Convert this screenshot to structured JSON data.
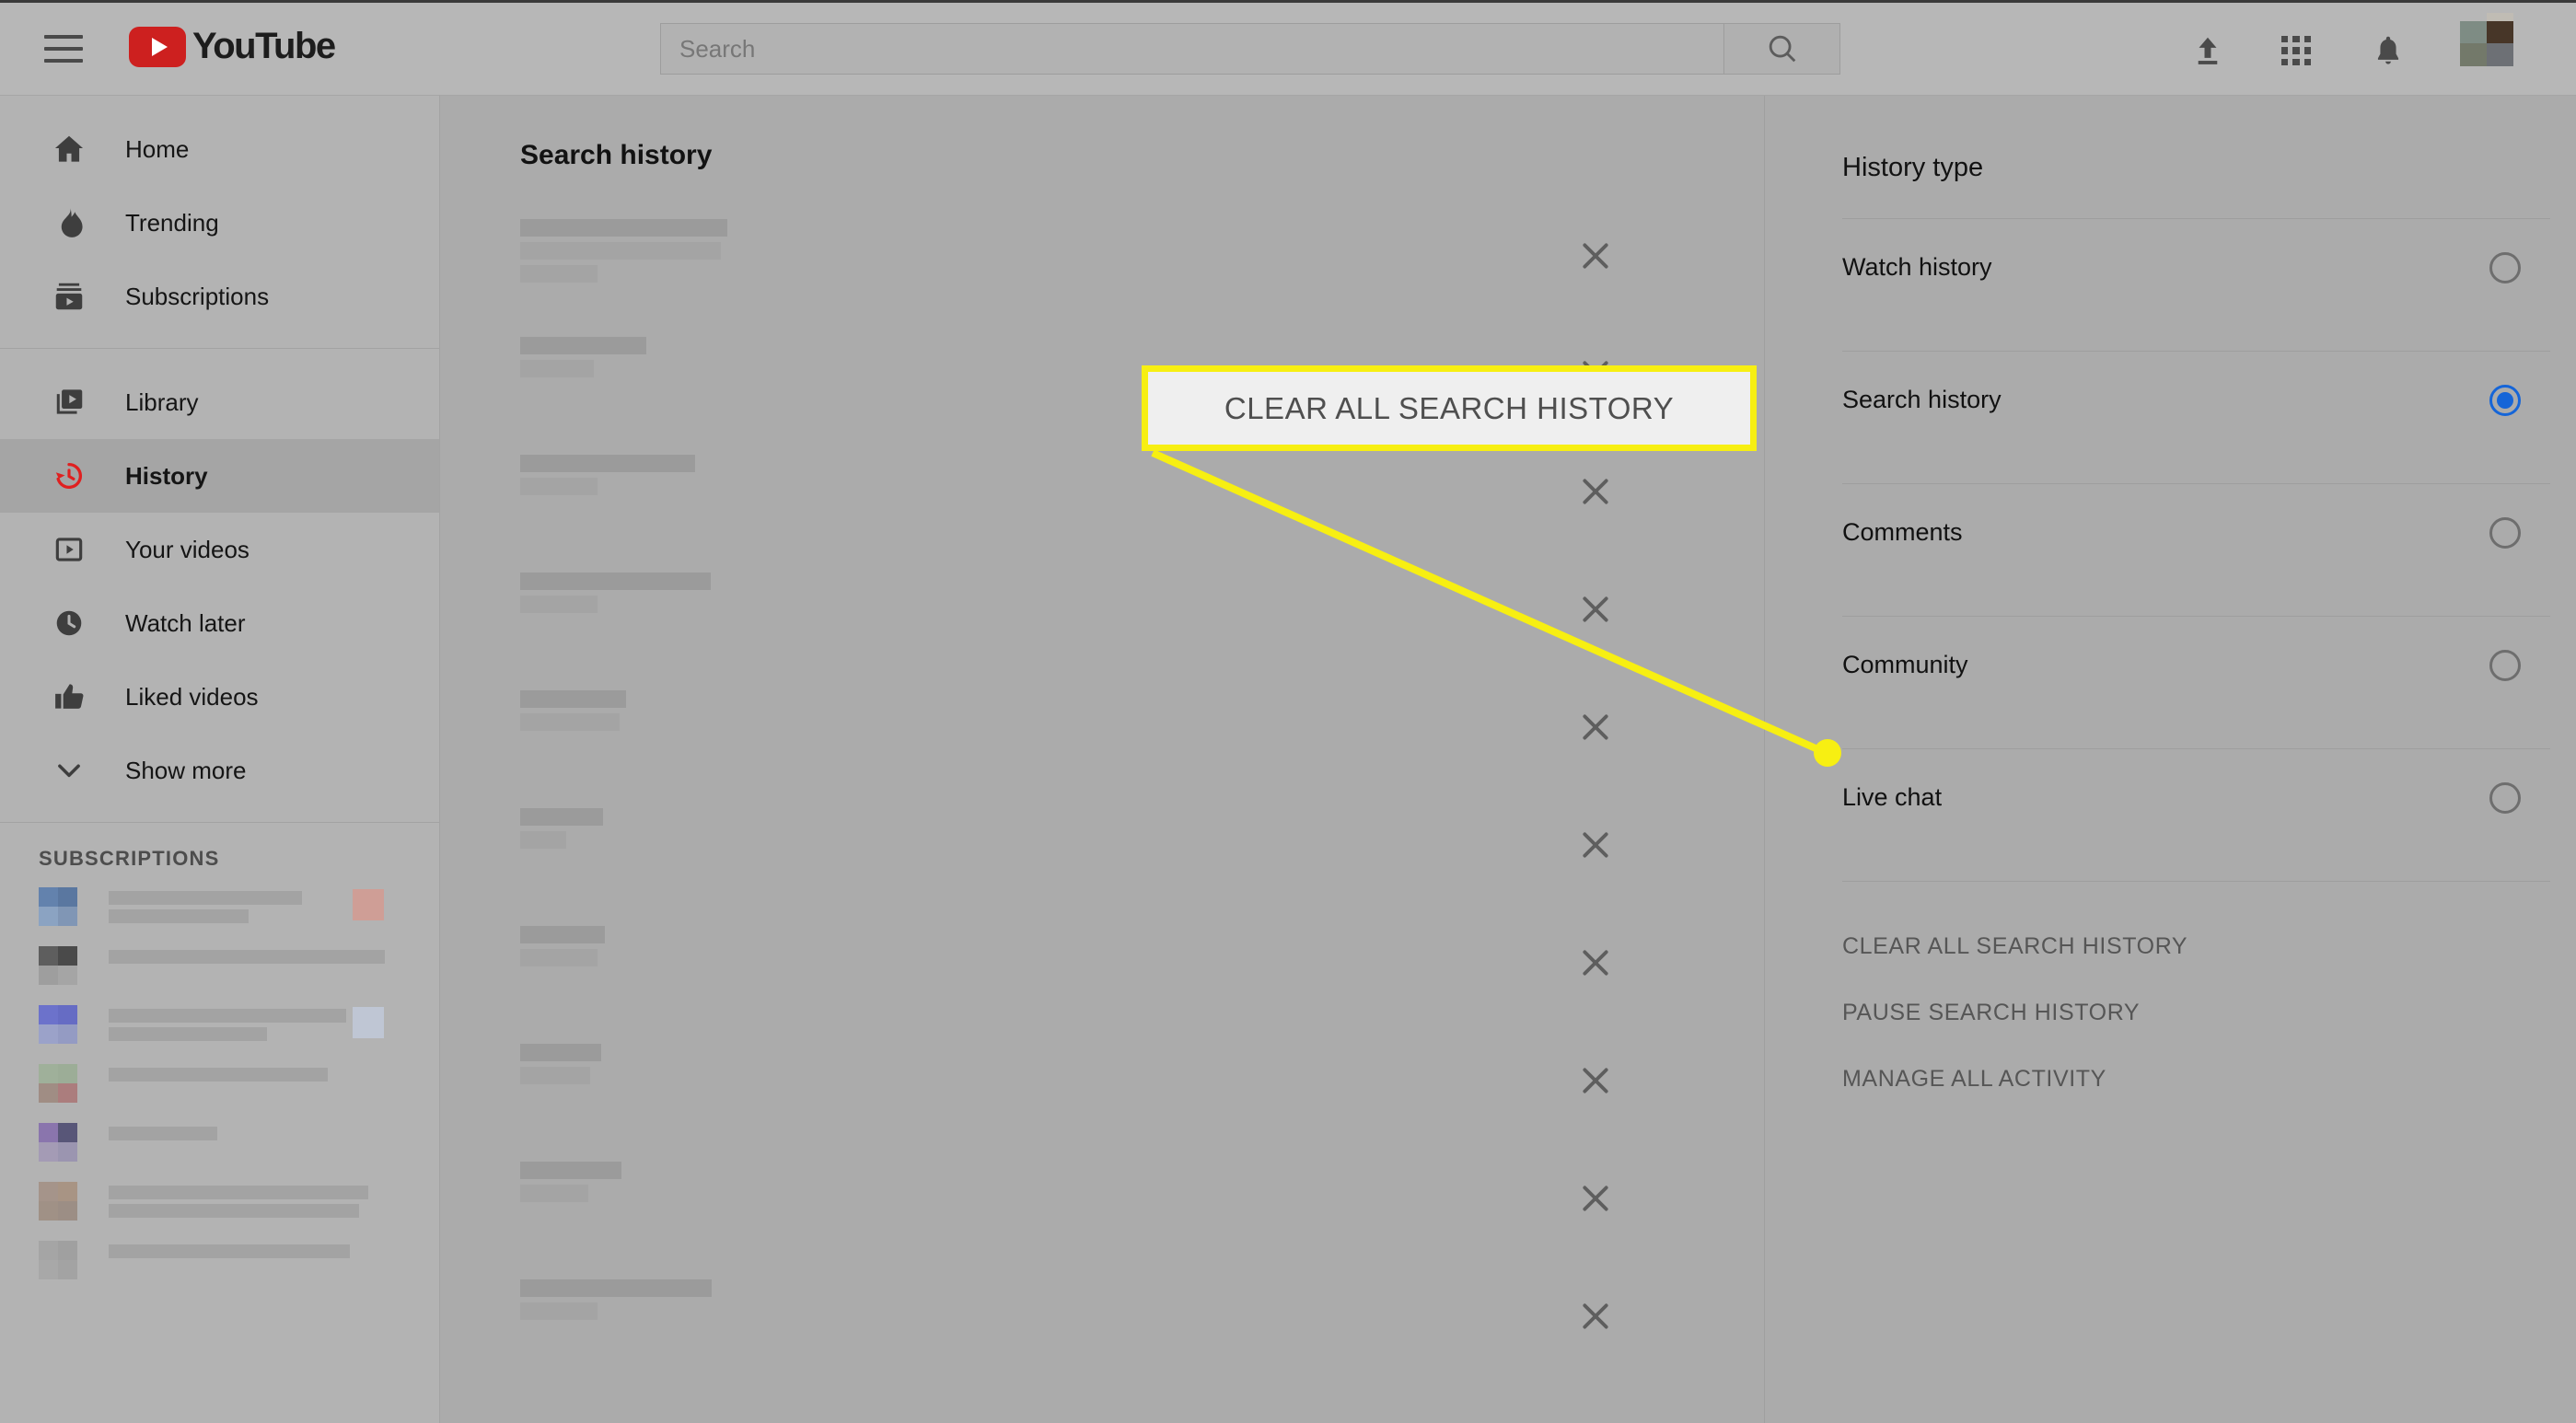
{
  "header": {
    "menu_icon": "hamburger-menu-icon",
    "logo_text": "YouTube",
    "search_placeholder": "Search",
    "search_value": "",
    "search_button_icon": "search-icon",
    "upload_icon": "upload-icon",
    "apps_icon": "apps-grid-icon",
    "notifications_icon": "bell-icon",
    "avatar_icon": "user-avatar"
  },
  "sidebar": {
    "primary": [
      {
        "label": "Home",
        "icon": "home-icon",
        "active": false
      },
      {
        "label": "Trending",
        "icon": "flame-icon",
        "active": false
      },
      {
        "label": "Subscriptions",
        "icon": "subscriptions-icon",
        "active": false
      }
    ],
    "secondary": [
      {
        "label": "Library",
        "icon": "library-icon",
        "active": false
      },
      {
        "label": "History",
        "icon": "history-clock-icon",
        "active": true
      },
      {
        "label": "Your videos",
        "icon": "your-videos-icon",
        "active": false
      },
      {
        "label": "Watch later",
        "icon": "clock-icon",
        "active": false
      },
      {
        "label": "Liked videos",
        "icon": "thumbs-up-icon",
        "active": false
      },
      {
        "label": "Show more",
        "icon": "chevron-down-icon",
        "active": false
      }
    ],
    "subscriptions_header": "SUBSCRIPTIONS",
    "subscriptions": [
      {
        "avatar_colors": [
          "#6382ad",
          "#5a77a0",
          "#8ba3c2",
          "#8096b5"
        ],
        "name_widths": [
          210,
          152
        ],
        "badge_color": "#cf9e96"
      },
      {
        "avatar_colors": [
          "#5e5e5e",
          "#4a4a4a",
          "#9e9e9e",
          "#a5a5a5"
        ],
        "name_widths": [
          300,
          0
        ],
        "badge_color": "#d18b81"
      },
      {
        "avatar_colors": [
          "#6c72cb",
          "#666cc4",
          "#9ba2c9",
          "#949bc3"
        ],
        "name_widths": [
          258,
          172
        ],
        "badge_color": "#bfc6d4"
      },
      {
        "avatar_colors": [
          "#9fb09a",
          "#9cad97",
          "#a08d84",
          "#ab7d7d"
        ],
        "name_widths": [
          238,
          0
        ],
        "badge_color": ""
      },
      {
        "avatar_colors": [
          "#8a75ad",
          "#585678",
          "#a49bb5",
          "#9b95b0"
        ],
        "name_widths": [
          118,
          0
        ],
        "badge_color": ""
      },
      {
        "avatar_colors": [
          "#a5948a",
          "#a89484",
          "#a09186",
          "#9c8e85"
        ],
        "name_widths": [
          282,
          272
        ],
        "badge_color": ""
      },
      {
        "avatar_colors": [
          "#a5a5a5",
          "#a0a0a0",
          "#a8a8a8",
          "#a3a3a3"
        ],
        "name_widths": [
          262,
          0
        ],
        "badge_color": ""
      }
    ]
  },
  "main": {
    "title": "Search history",
    "remove_icon": "close-x-icon",
    "entries": [
      {
        "line_widths": [
          225,
          218,
          84
        ]
      },
      {
        "line_widths": [
          137,
          80
        ]
      },
      {
        "line_widths": [
          190,
          84
        ]
      },
      {
        "line_widths": [
          207,
          84
        ]
      },
      {
        "line_widths": [
          115,
          108
        ]
      },
      {
        "line_widths": [
          90,
          50
        ]
      },
      {
        "line_widths": [
          92,
          84
        ]
      },
      {
        "line_widths": [
          88,
          76
        ]
      },
      {
        "line_widths": [
          110,
          74
        ]
      },
      {
        "line_widths": [
          208,
          84
        ]
      }
    ]
  },
  "right_panel": {
    "title": "History type",
    "options": [
      {
        "label": "Watch history",
        "selected": false
      },
      {
        "label": "Search history",
        "selected": true
      },
      {
        "label": "Comments",
        "selected": false
      },
      {
        "label": "Community",
        "selected": false
      },
      {
        "label": "Live chat",
        "selected": false
      }
    ],
    "actions": [
      "CLEAR ALL SEARCH HISTORY",
      "PAUSE SEARCH HISTORY",
      "MANAGE ALL ACTIVITY"
    ]
  },
  "callout": {
    "label": "CLEAR ALL SEARCH HISTORY",
    "border_color": "#f7ef12",
    "background_color": "#efefef",
    "pointer_color": "#f7ef12"
  }
}
